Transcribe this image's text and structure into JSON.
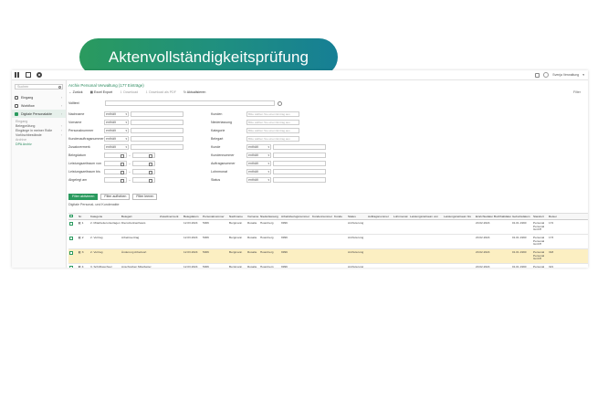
{
  "banner": {
    "title": "Aktenvollständigkeitsprüfung"
  },
  "topbar": {
    "user": "Svenja Verwaltung"
  },
  "sidebar": {
    "search_placeholder": "Suchen",
    "items": [
      {
        "label": "Eingang"
      },
      {
        "label": "Workflow"
      },
      {
        "label": "Digitale Personalakte"
      }
    ],
    "sub_items": [
      {
        "label": "Eingang",
        "type": "sec"
      },
      {
        "label": "Belegprüfung",
        "type": "normal"
      },
      {
        "label": "Eingänge in meiner Rolle",
        "type": "normal"
      },
      {
        "label": "Vorlöschbestände",
        "type": "normal"
      },
      {
        "label": "Archive",
        "type": "sec"
      },
      {
        "label": "DPA Archiv",
        "type": "link"
      }
    ]
  },
  "content": {
    "breadcrumb": "Archiv Personal Verwaltung (177 Einträge)",
    "toolbar": [
      "Zurück",
      "Excel Export",
      "Download",
      "Download als PDF",
      "Aktualisieren"
    ],
    "filter_label": "Filter",
    "quick_label": "Volltext",
    "form_left": [
      {
        "label": "Nachname",
        "op": "enthält",
        "kind": "text"
      },
      {
        "label": "Vorname",
        "op": "enthält",
        "kind": "text"
      },
      {
        "label": "Personalnummer",
        "op": "enthält",
        "kind": "text"
      },
      {
        "label": "Kundenauftragsnummer",
        "op": "enthält",
        "kind": "text"
      },
      {
        "label": "Zusatzvermerk",
        "op": "enthält",
        "kind": "text"
      },
      {
        "label": "Belegdatum",
        "kind": "date"
      },
      {
        "label": "Leistungszeitraum von",
        "kind": "date"
      },
      {
        "label": "Leistungszeitraum bis",
        "kind": "date"
      },
      {
        "label": "Abgelegt am",
        "kind": "date"
      }
    ],
    "form_right": [
      {
        "label": "Kunden",
        "placeholder": "Bitte wählen Sie einen Eintrag aus",
        "kind": "ph"
      },
      {
        "label": "Niederlassung",
        "placeholder": "Bitte wählen Sie einen Eintrag aus",
        "kind": "ph"
      },
      {
        "label": "Kategorie",
        "placeholder": "Bitte wählen Sie einen Eintrag aus",
        "kind": "ph"
      },
      {
        "label": "Belegart",
        "placeholder": "Bitte wählen Sie einen Eintrag aus",
        "kind": "ph"
      },
      {
        "label": "Kunde",
        "op": "enthält",
        "kind": "text"
      },
      {
        "label": "Kundennummer",
        "op": "enthält",
        "kind": "text"
      },
      {
        "label": "Auftragsnummer",
        "op": "enthält",
        "kind": "text"
      },
      {
        "label": "Lohnmonat",
        "op": "enthält",
        "kind": "text"
      },
      {
        "label": "Status",
        "op": "enthält",
        "kind": "text"
      }
    ],
    "buttons": [
      "Filter aktivieren",
      "Filter aufheben",
      "Filter leeren"
    ],
    "saved_filter": "Digitale Personal- und Kundenakte",
    "table": {
      "columns": [
        {
          "label": "",
          "w": 10
        },
        {
          "label": "Nr.",
          "w": 13
        },
        {
          "label": "Kategorie",
          "w": 34
        },
        {
          "label": "Belegart",
          "w": 42
        },
        {
          "label": "Zusatzvermerk",
          "w": 26
        },
        {
          "label": "Belegdatum",
          "w": 21
        },
        {
          "label": "Personalnummer",
          "w": 29
        },
        {
          "label": "Nachname",
          "w": 20
        },
        {
          "label": "Vorname",
          "w": 14
        },
        {
          "label": "Niederlassung",
          "w": 23
        },
        {
          "label": "Arbeitsbezugsnummer",
          "w": 34
        },
        {
          "label": "Kundennummer",
          "w": 24
        },
        {
          "label": "Kunde",
          "w": 15
        },
        {
          "label": "Status",
          "w": 22
        },
        {
          "label": "Auftragsnummer",
          "w": 28
        },
        {
          "label": "Lohnmonat",
          "w": 18
        },
        {
          "label": "Leistungszeitraum von",
          "w": 37
        },
        {
          "label": "Leistungszeitraum bis",
          "w": 35
        },
        {
          "label": "Einrichtedatum",
          "w": 20
        },
        {
          "label": "Buchhaltdatum",
          "w": 20
        },
        {
          "label": "Geburtsdatum",
          "w": 23
        },
        {
          "label": "Standort",
          "w": 17
        },
        {
          "label": "Reisen",
          "w": 10
        }
      ],
      "rows": [
        {
          "nr": "1",
          "kategorie": "2. Mitarbeiterunterlagen",
          "belegart": "Dienstzeitnachweis",
          "zusatz": "",
          "belegdatum": "12.03.2024",
          "personal": "5006",
          "nachname": "Bergmann",
          "vorname": "Rosalie",
          "nl": "Hoamberg",
          "abn": "9999",
          "kdnr": "",
          "kunde": "",
          "status": "Archivierung",
          "auftrag": "",
          "lohn": "",
          "lzv": "",
          "lzb": "",
          "einr": "20.02.2024",
          "buch": "",
          "geb": "01.01.1990",
          "standort": "Personal Personal GmbH",
          "reisen": "172",
          "hl": false
        },
        {
          "nr": "2",
          "kategorie": "2. Vertrag",
          "belegart": "Arbeitsvertrag",
          "zusatz": "",
          "belegdatum": "12.03.2024",
          "personal": "5006",
          "nachname": "Bergmann",
          "vorname": "Rosalie",
          "nl": "Hoamberg",
          "abn": "9999",
          "kdnr": "",
          "kunde": "",
          "status": "Archivierung",
          "auftrag": "",
          "lohn": "",
          "lzv": "",
          "lzb": "",
          "einr": "20.02.2024",
          "buch": "",
          "geb": "01.01.1990",
          "standort": "Personal Personal GmbH",
          "reisen": "173",
          "hl": false
        },
        {
          "nr": "3",
          "kategorie": "2. Vertrag",
          "belegart": "Änderung Arbeitsort",
          "zusatz": "",
          "belegdatum": "12.03.2024",
          "personal": "5006",
          "nachname": "Bergmann",
          "vorname": "Rosalie",
          "nl": "Hoamberg",
          "abn": "9999",
          "kdnr": "",
          "kunde": "",
          "status": "Archivierung",
          "auftrag": "",
          "lohn": "",
          "lzv": "",
          "lzb": "",
          "einr": "20.02.2024",
          "buch": "",
          "geb": "01.01.1990",
          "standort": "Personal Personal GmbH",
          "reisen": "318",
          "hl": true
        },
        {
          "nr": "4",
          "kategorie": "3. Schriftwechsel",
          "belegart": "Anschreiben Mitarbeiter",
          "zusatz": "",
          "belegdatum": "12.03.2024",
          "personal": "5006",
          "nachname": "Bergmann",
          "vorname": "Rosalie",
          "nl": "Hoamberg",
          "abn": "9999",
          "kdnr": "",
          "kunde": "",
          "status": "Archivierung",
          "auftrag": "",
          "lohn": "",
          "lzv": "",
          "lzb": "",
          "einr": "20.02.2024",
          "buch": "",
          "geb": "01.01.1990",
          "standort": "Personal Personal GmbH",
          "reisen": "321",
          "hl": false
        }
      ]
    }
  }
}
